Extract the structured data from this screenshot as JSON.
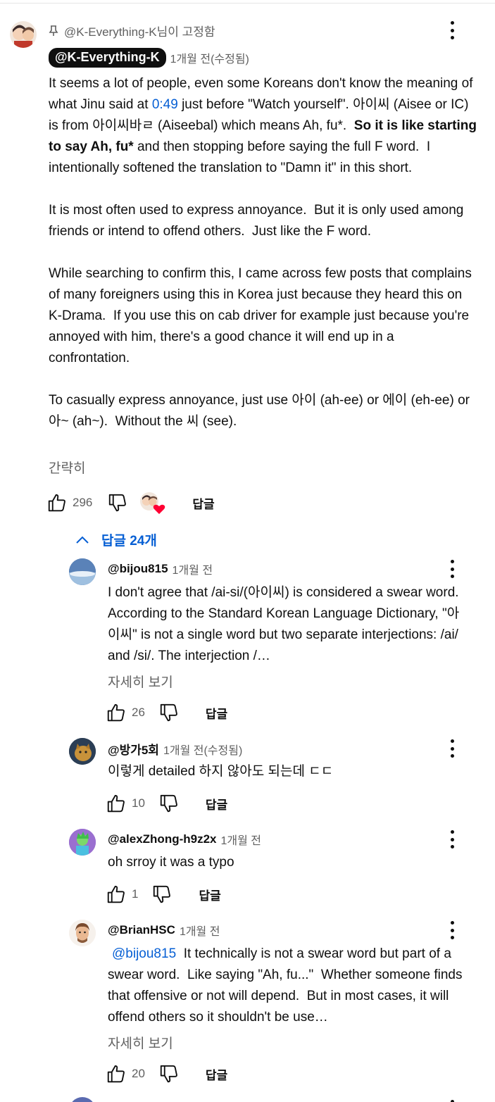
{
  "pinned": {
    "label": "@K-Everything-K님이 고정함",
    "author": "@K-Everything-K",
    "time": "1개월 전(수정됨)",
    "text_parts": [
      {
        "t": "It seems a lot of people, even some Koreans don't know the meaning of what Jinu said at ",
        "style": "normal"
      },
      {
        "t": "0:49",
        "style": "link"
      },
      {
        "t": " just before \"Watch yourself\". 아이씨 (Aisee or IC) is from 아이씨바ㄹ (Aiseebal) which means Ah, fu*.  ",
        "style": "normal"
      },
      {
        "t": "So it is like starting to say Ah, fu*",
        "style": "bold"
      },
      {
        "t": " and then stopping before saying the full F word.  I intentionally softened the translation to \"Damn it\" in this short.\n\nIt is most often used to express annoyance.  But it is only used among friends or intend to offend others.  Just like the F word.\n\nWhile searching to confirm this, I came across few posts that complains of many foreigners using this in Korea just because they heard this on K-Drama.  If you use this on cab driver for example just because you're annoyed with him, there's a good chance it will end up in a confrontation.\n\nTo casually express annoyance, just use 아이 (ah-ee) or 에이 (eh-ee) or 아~ (ah~).  Without the 씨 (see).",
        "style": "normal"
      }
    ],
    "collapse_label": "간략히",
    "likes": "296",
    "reply_label": "답글"
  },
  "replies_toggle": {
    "label": "답글 24개"
  },
  "replies": [
    {
      "author": "@bijou815",
      "time": "1개월 전",
      "mention": "",
      "text": "I don't agree that /ai-si/(아이씨) is considered a swear word. According to the Standard Korean Language Dictionary, \"아이씨\" is not a single word but two separate interjections: /ai/ and /si/. The interjection /…",
      "more_label": "자세히 보기",
      "likes": "26",
      "reply_label": "답글",
      "avatar_color": "#6f8fb8"
    },
    {
      "author": "@방가5회",
      "time": "1개월 전(수정됨)",
      "mention": "",
      "text": "이렇게 detailed 하지 않아도 되는데 ㄷㄷ",
      "more_label": "",
      "likes": "10",
      "reply_label": "답글",
      "avatar_color": "#4a3a2a"
    },
    {
      "author": "@alexZhong-h9z2x",
      "time": "1개월 전",
      "mention": "",
      "text": "oh srroy it was a typo",
      "more_label": "",
      "likes": "1",
      "reply_label": "답글",
      "avatar_color": "#8b5fc8"
    },
    {
      "author": "@BrianHSC",
      "time": "1개월 전",
      "mention": "@bijou815",
      "text": "It technically is not a swear word but part of a swear word.  Like saying \"Ah, fu...\"  Whether someone finds that offensive or not will depend.  But in most cases, it will offend others so it shouldn't be use…",
      "more_label": "자세히 보기",
      "likes": "20",
      "reply_label": "답글",
      "avatar_color": "#c8a080"
    }
  ],
  "icons": {
    "pin": "pin-icon",
    "like": "thumb-up-icon",
    "dislike": "thumb-down-icon",
    "menu": "more-vertical-icon",
    "chevron": "chevron-up-icon",
    "creator_heart": "creator-heart-avatar"
  },
  "colors": {
    "link": "#065fd4",
    "secondary": "#606060",
    "heart": "#ff0033"
  }
}
